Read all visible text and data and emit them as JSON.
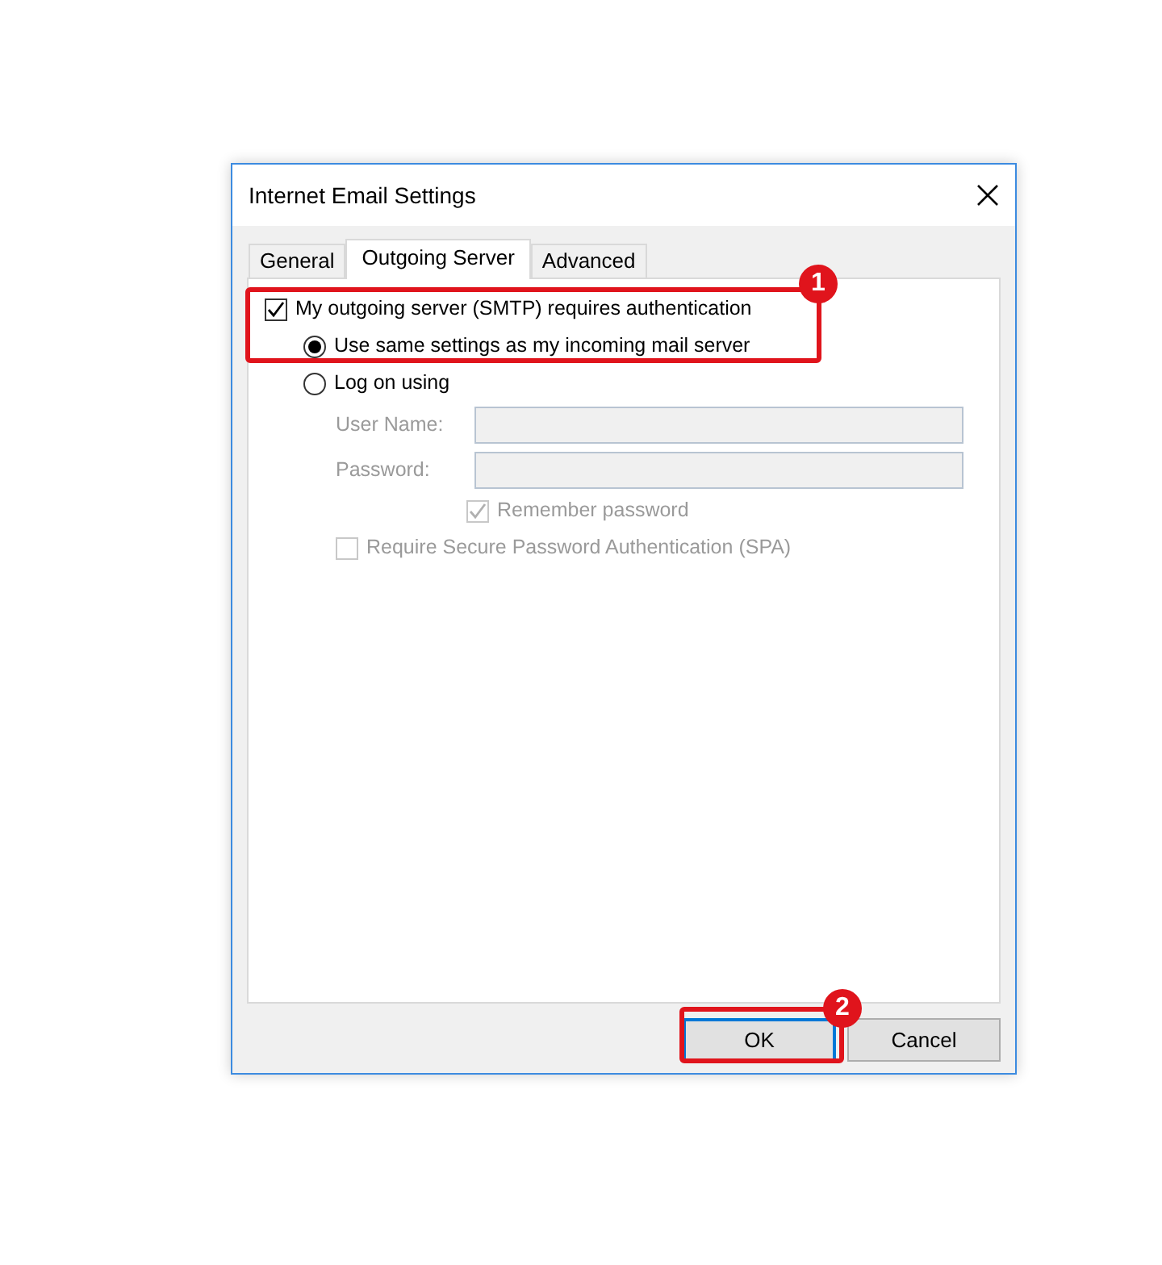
{
  "window": {
    "title": "Internet Email Settings"
  },
  "tabs": [
    {
      "label": "General",
      "selected": false
    },
    {
      "label": "Outgoing Server",
      "selected": true
    },
    {
      "label": "Advanced",
      "selected": false
    }
  ],
  "auth": {
    "label": "My outgoing server (SMTP) requires authentication",
    "checked": true
  },
  "modes": [
    {
      "label": "Use same settings as my incoming mail server",
      "selected": true
    },
    {
      "label": "Log on using",
      "selected": false
    }
  ],
  "fields": [
    {
      "label": "User Name:",
      "disabled": true
    },
    {
      "label": "Password:",
      "disabled": true
    }
  ],
  "remember": {
    "label": "Remember password",
    "checked": true,
    "disabled": true
  },
  "spa": {
    "label": "Require Secure Password Authentication (SPA)",
    "checked": false,
    "disabled": true
  },
  "buttons": [
    {
      "label": "OK",
      "default": true
    },
    {
      "label": "Cancel",
      "default": false
    }
  ],
  "callouts": [
    {
      "number": "1"
    },
    {
      "number": "2"
    }
  ]
}
